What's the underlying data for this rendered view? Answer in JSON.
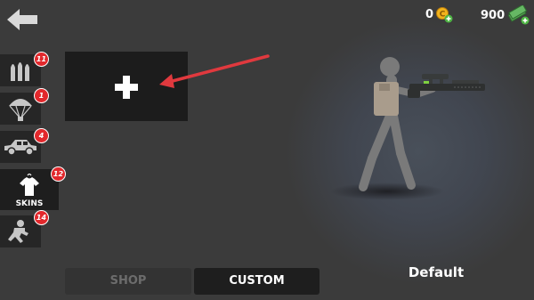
{
  "currency": {
    "gold_amount": "0",
    "cash_amount": "900"
  },
  "sidebar": {
    "items": [
      {
        "name": "ammo",
        "badge": "11"
      },
      {
        "name": "parachute",
        "badge": "1"
      },
      {
        "name": "vehicle",
        "badge": "4"
      },
      {
        "name": "skins",
        "label": "SKINS",
        "badge": "12",
        "active": true
      },
      {
        "name": "pose",
        "badge": "14"
      }
    ]
  },
  "custom_slot": {
    "icon": "plus-icon"
  },
  "tabs": [
    {
      "label": "SHOP",
      "selected": false
    },
    {
      "label": "CUSTOM",
      "selected": true
    }
  ],
  "skin_name": "Default",
  "colors": {
    "background": "#3b3b3b",
    "badge": "#e2282c",
    "arrow": "#e0393e",
    "character": "#7a7a7a",
    "vest": "#a99c8c"
  }
}
